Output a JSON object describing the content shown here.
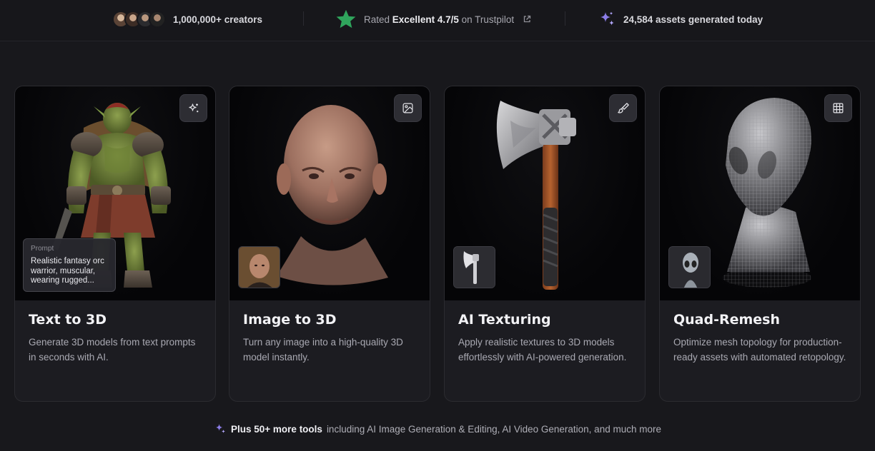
{
  "stats": {
    "creators": "1,000,000+ creators",
    "rating_prefix": "Rated",
    "rating_word": "Excellent",
    "rating_value": "4.7/5",
    "rating_suffix": "on Trustpilot",
    "assets": "24,584 assets generated today"
  },
  "colors": {
    "background": "#18181c",
    "card": "#1c1c21",
    "trustpilot_star": "#2fa55c",
    "sparkle": "#8c7de8"
  },
  "cards": [
    {
      "title": "Text to 3D",
      "description": "Generate 3D models from text prompts in seconds with AI.",
      "corner_icon": "sparkles-icon",
      "prompt_label": "Prompt",
      "prompt_text": "Realistic fantasy orc warrior, muscular, wearing rugged..."
    },
    {
      "title": "Image to 3D",
      "description": "Turn any image into a high-quality 3D model instantly.",
      "corner_icon": "image-icon"
    },
    {
      "title": "AI Texturing",
      "description": "Apply realistic textures to 3D models effortlessly with AI-powered generation.",
      "corner_icon": "paintbrush-icon"
    },
    {
      "title": "Quad-Remesh",
      "description": "Optimize mesh topology for production-ready assets with automated retopology.",
      "corner_icon": "grid-icon"
    }
  ],
  "footer": {
    "highlight": "Plus 50+ more tools",
    "rest": "including AI Image Generation & Editing, AI Video Generation, and much more"
  }
}
